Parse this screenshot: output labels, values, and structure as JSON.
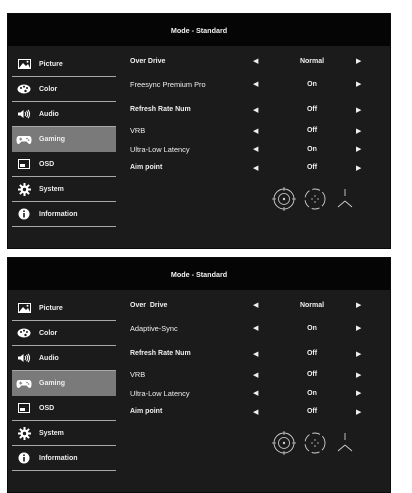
{
  "panels": [
    {
      "title": "Mode - Standard",
      "sidebar": [
        {
          "label": "Picture",
          "icon": "picture-icon",
          "selected": false
        },
        {
          "label": "Color",
          "icon": "palette-icon",
          "selected": false
        },
        {
          "label": "Audio",
          "icon": "speaker-icon",
          "selected": false
        },
        {
          "label": "Gaming",
          "icon": "gamepad-icon",
          "selected": true
        },
        {
          "label": "OSD",
          "icon": "osd-icon",
          "selected": false
        },
        {
          "label": "System",
          "icon": "gear-icon",
          "selected": false
        },
        {
          "label": "Information",
          "icon": "info-icon",
          "selected": false
        }
      ],
      "settings": [
        {
          "label": "Over Drive",
          "value": "Normal"
        },
        {
          "label": "Freesync Premium Pro",
          "value": "On"
        },
        {
          "label": "Refresh Rate Num",
          "value": "Off"
        },
        {
          "label": "VRB",
          "value": "Off"
        },
        {
          "label": "Ultra-Low Latency",
          "value": "On"
        },
        {
          "label": "Aim point",
          "value": "Off"
        }
      ]
    },
    {
      "title": "Mode - Standard",
      "sidebar": [
        {
          "label": "Picture",
          "icon": "picture-icon",
          "selected": false
        },
        {
          "label": "Color",
          "icon": "palette-icon",
          "selected": false
        },
        {
          "label": "Audio",
          "icon": "speaker-icon",
          "selected": false
        },
        {
          "label": "Gaming",
          "icon": "gamepad-icon",
          "selected": true
        },
        {
          "label": "OSD",
          "icon": "osd-icon",
          "selected": false
        },
        {
          "label": "System",
          "icon": "gear-icon",
          "selected": false
        },
        {
          "label": "Information",
          "icon": "info-icon",
          "selected": false
        }
      ],
      "settings": [
        {
          "label": "Over  Drive",
          "value": "Normal"
        },
        {
          "label": "Adaptive-Sync",
          "value": "On"
        },
        {
          "label": "Refresh Rate Num",
          "value": "Off"
        },
        {
          "label": "VRB",
          "value": "Off"
        },
        {
          "label": "Ultra-Low Latency",
          "value": "On"
        },
        {
          "label": "Aim point",
          "value": "Off"
        }
      ]
    }
  ],
  "arrows": {
    "left": "◀",
    "right": "▶"
  },
  "aim_point_icons": [
    "aim-point-circle-icon",
    "aim-point-dashed-circle-icon",
    "aim-point-tri-line-icon"
  ],
  "colors": {
    "panel_bg": "#1b1b1b",
    "topbar_bg": "#050505",
    "selected_bg": "#7a7a7a",
    "text": "#f0f0f0"
  }
}
